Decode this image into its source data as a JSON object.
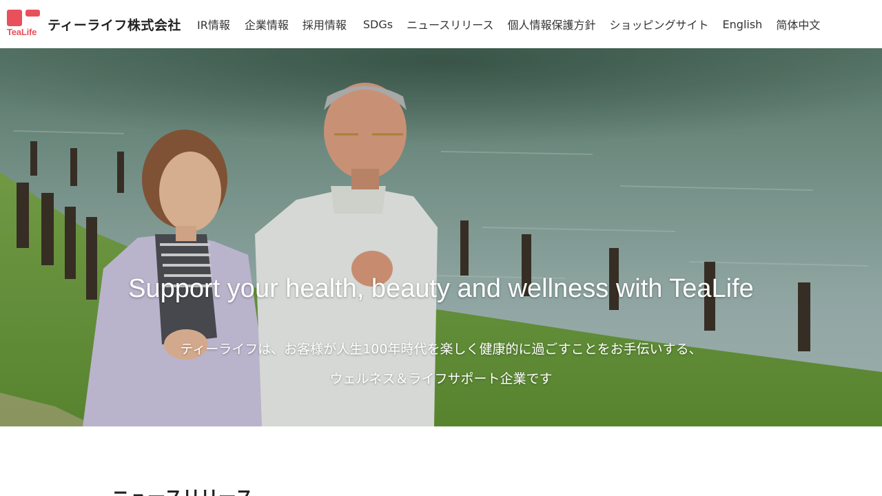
{
  "brand": {
    "logo_word": "TeaLife",
    "company_name": "ティーライフ株式会社",
    "accent_color": "#e8505b"
  },
  "nav": {
    "items": [
      {
        "label": "IR情報"
      },
      {
        "label": "企業情報"
      },
      {
        "label": "採用情報"
      },
      {
        "label": "SDGs"
      },
      {
        "label": "ニュースリリース"
      },
      {
        "label": "個人情報保護方針"
      },
      {
        "label": "ショッピングサイト"
      },
      {
        "label": "English"
      },
      {
        "label": "简体中文"
      }
    ]
  },
  "hero": {
    "title": "Support your health, beauty and wellness with TeaLife",
    "subtitle_line1": "ティーライフは、お客様が人生100年時代を楽しく健康的に過ごすことをお手伝いする、",
    "subtitle_line2": "ウェルネス＆ライフサポート企業です",
    "image_description_icon": "photo-elderly-couple-jogging"
  },
  "news": {
    "section_title": "ニュースリリース"
  }
}
